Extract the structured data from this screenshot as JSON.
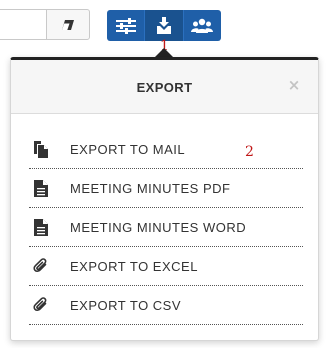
{
  "toolbar": {
    "search_placeholder": "",
    "buttons": [
      {
        "icon": "sliders-icon"
      },
      {
        "icon": "export-icon",
        "active": true
      },
      {
        "icon": "users-icon"
      }
    ]
  },
  "annotations": {
    "marker_1": "1",
    "marker_2": "2"
  },
  "popover": {
    "title": "EXPORT",
    "close_label": "×",
    "items": [
      {
        "label": "EXPORT TO MAIL",
        "icon": "copy-docs-icon"
      },
      {
        "label": "MEETING MINUTES PDF",
        "icon": "document-icon"
      },
      {
        "label": "MEETING MINUTES WORD",
        "icon": "document-icon"
      },
      {
        "label": "EXPORT TO EXCEL",
        "icon": "paperclip-icon"
      },
      {
        "label": "EXPORT TO CSV",
        "icon": "paperclip-icon"
      }
    ]
  },
  "colors": {
    "toolbar_blue": "#1f5fa8",
    "popover_border_top": "#222222",
    "annotation_red": "#c01818",
    "menu_text": "#333333"
  }
}
